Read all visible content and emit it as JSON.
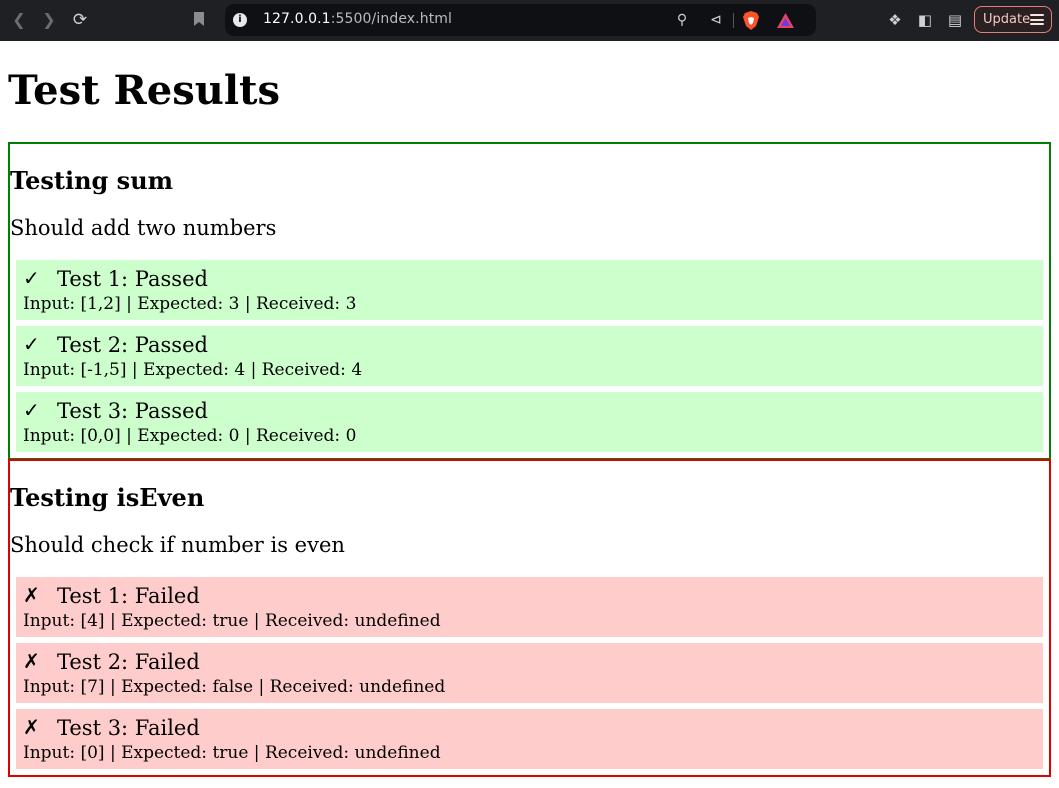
{
  "browser": {
    "url_host": "127.0.0.1",
    "url_rest": ":5500/index.html",
    "update_label": "Update"
  },
  "page": {
    "title": "Test Results",
    "suites": [
      {
        "status": "pass",
        "heading": "Testing sum",
        "description": "Should add two numbers",
        "tests": [
          {
            "mark": "✓",
            "title": "Test 1: Passed",
            "detail": "Input: [1,2] | Expected: 3 | Received: 3"
          },
          {
            "mark": "✓",
            "title": "Test 2: Passed",
            "detail": "Input: [-1,5] | Expected: 4 | Received: 4"
          },
          {
            "mark": "✓",
            "title": "Test 3: Passed",
            "detail": "Input: [0,0] | Expected: 0 | Received: 0"
          }
        ]
      },
      {
        "status": "fail",
        "heading": "Testing isEven",
        "description": "Should check if number is even",
        "tests": [
          {
            "mark": "✗",
            "title": "Test 1: Failed",
            "detail": "Input: [4] | Expected: true | Received: undefined"
          },
          {
            "mark": "✗",
            "title": "Test 2: Failed",
            "detail": "Input: [7] | Expected: false | Received: undefined"
          },
          {
            "mark": "✗",
            "title": "Test 3: Failed",
            "detail": "Input: [0] | Expected: true | Received: undefined"
          }
        ]
      }
    ]
  },
  "colors": {
    "pass_border": "#008000",
    "pass_bg": "#ccffcc",
    "fail_border": "#e00000",
    "fail_bg": "#ffcccc"
  }
}
